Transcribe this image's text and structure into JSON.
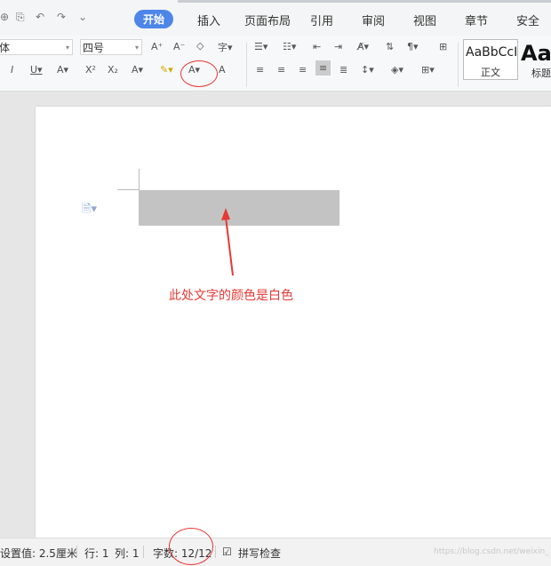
{
  "quick_access": [
    "⊕",
    "⎘",
    "↶",
    "↷",
    "⌄"
  ],
  "tabs": [
    {
      "label": "开始",
      "active": true
    },
    {
      "label": "插入"
    },
    {
      "label": "页面布局"
    },
    {
      "label": "引用"
    },
    {
      "label": "审阅"
    },
    {
      "label": "视图"
    },
    {
      "label": "章节"
    },
    {
      "label": "安全"
    }
  ],
  "ribbon": {
    "font_name": "体",
    "font_size": "四号",
    "styles": [
      {
        "sample": "AaBbCcI",
        "name": "正文"
      },
      {
        "sample": "AaI",
        "name": "标题"
      }
    ]
  },
  "document": {
    "annotation": "此处文字的颜色是白色",
    "highlight_color": "#c3c3c3",
    "annotation_color": "#e53935"
  },
  "status": {
    "setting": "设置值: 2.5厘米",
    "row": "行: 1",
    "col": "列: 1",
    "word_count": "字数: 12/12",
    "spell_check": "拼写检查"
  },
  "watermark": "https://blog.csdn.net/weixin_"
}
